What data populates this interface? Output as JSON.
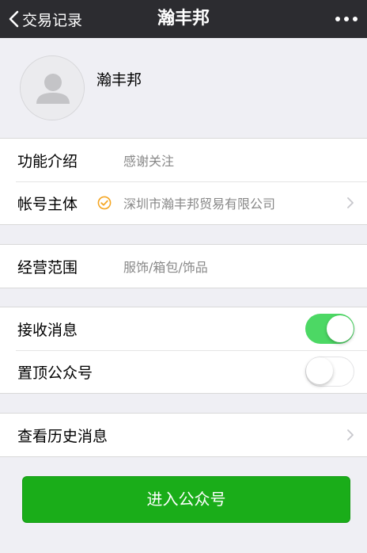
{
  "navbar": {
    "back_label": "交易记录",
    "title": "瀚丰邦",
    "more_icon": "more-dots-icon"
  },
  "profile": {
    "name": "瀚丰邦",
    "avatar_icon": "default-avatar-icon"
  },
  "info_group": {
    "rows": [
      {
        "label": "功能介绍",
        "value": "感谢关注"
      },
      {
        "label": "帐号主体",
        "value": "深圳市瀚丰邦贸易有限公司",
        "badge_icon": "verified-check-icon",
        "badge_color": "#f5a623"
      }
    ]
  },
  "business_group": {
    "rows": [
      {
        "label": "经营范围",
        "value": "服饰/箱包/饰品"
      }
    ]
  },
  "settings_group": {
    "rows": [
      {
        "label": "接收消息",
        "toggle_on": true
      },
      {
        "label": "置顶公众号",
        "toggle_on": false
      }
    ]
  },
  "history_group": {
    "rows": [
      {
        "label": "查看历史消息"
      }
    ]
  },
  "enter_button": {
    "label": "进入公众号",
    "color": "#1aad19"
  },
  "colors": {
    "navbar_bg": "#2c2c30",
    "page_bg": "#efeff4",
    "toggle_on": "#4cd864"
  }
}
